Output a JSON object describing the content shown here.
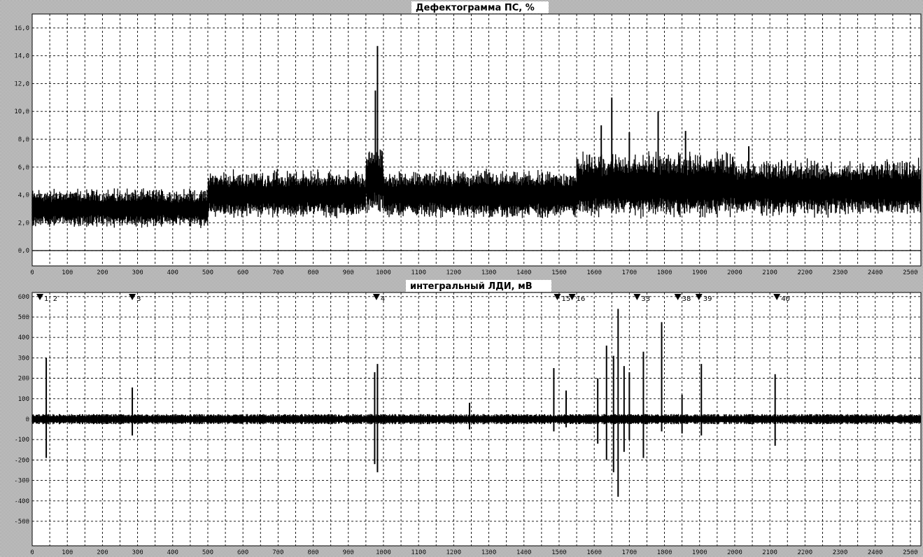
{
  "chart_data": [
    {
      "type": "line",
      "title": "Дефектограмма ПС, %",
      "ytick_labels": [
        "16,0",
        "14,0",
        "12,0",
        "10,0",
        "8,0",
        "6,0",
        "4,0",
        "2,0",
        "0,0"
      ],
      "y_ticks": [
        16,
        14,
        12,
        10,
        8,
        6,
        4,
        2,
        0
      ],
      "ylim": [
        -1.1,
        17.0
      ],
      "xlim": [
        0,
        2530
      ],
      "xtick_labels": [
        "0",
        "100",
        "200",
        "300",
        "400",
        "500",
        "600",
        "700",
        "800",
        "900",
        "1000",
        "1100",
        "1200",
        "1300",
        "1400",
        "1500",
        "1600",
        "1700",
        "1800",
        "1900",
        "2000",
        "2100",
        "2200",
        "2300",
        "2400",
        "2500"
      ],
      "x_ticks": [
        0,
        100,
        200,
        300,
        400,
        500,
        600,
        700,
        800,
        900,
        1000,
        1100,
        1200,
        1300,
        1400,
        1500,
        1600,
        1700,
        1800,
        1900,
        2000,
        2100,
        2200,
        2300,
        2400,
        2500
      ],
      "grid": true,
      "series": [
        {
          "signal": "noise band",
          "segments": [
            {
              "x_start": 0,
              "x_end": 500,
              "center": 3.0,
              "amplitude": 1.3
            },
            {
              "x_start": 500,
              "x_end": 950,
              "center": 4.0,
              "amplitude": 1.6
            },
            {
              "x_start": 950,
              "x_end": 1000,
              "center": 5.0,
              "amplitude": 2.2
            },
            {
              "x_start": 1000,
              "x_end": 1550,
              "center": 4.0,
              "amplitude": 1.6
            },
            {
              "x_start": 1550,
              "x_end": 2000,
              "center": 4.6,
              "amplitude": 2.2
            },
            {
              "x_start": 2000,
              "x_end": 2530,
              "center": 4.4,
              "amplitude": 1.9
            }
          ],
          "peaks": [
            {
              "x": 983,
              "y": 14.7
            },
            {
              "x": 977,
              "y": 11.5
            },
            {
              "x": 1620,
              "y": 9.0
            },
            {
              "x": 1650,
              "y": 11.0
            },
            {
              "x": 1782,
              "y": 10.0
            },
            {
              "x": 1700,
              "y": 8.5
            },
            {
              "x": 1860,
              "y": 8.6
            },
            {
              "x": 2040,
              "y": 7.5
            }
          ]
        }
      ]
    },
    {
      "type": "line",
      "title": "интегральный ЛДИ, мВ",
      "ytick_labels": [
        "600",
        "500",
        "400",
        "300",
        "200",
        "100",
        "0",
        "-100",
        "-200",
        "-300",
        "-400",
        "-500"
      ],
      "y_ticks": [
        600,
        500,
        400,
        300,
        200,
        100,
        0,
        -100,
        -200,
        -300,
        -400,
        -500
      ],
      "ylim": [
        -620,
        620
      ],
      "xlim": [
        0,
        2530
      ],
      "xtick_labels": [
        "0",
        "100",
        "200",
        "300",
        "400",
        "500",
        "600",
        "700",
        "800",
        "900",
        "1000",
        "1100",
        "1200",
        "1300",
        "1400",
        "1500",
        "1600",
        "1700",
        "1800",
        "1900",
        "2000",
        "2100",
        "2200",
        "2300",
        "2400",
        "2500"
      ],
      "x_ticks": [
        0,
        100,
        200,
        300,
        400,
        500,
        600,
        700,
        800,
        900,
        1000,
        1100,
        1200,
        1300,
        1400,
        1500,
        1600,
        1700,
        1800,
        1900,
        2000,
        2100,
        2200,
        2300,
        2400,
        2500
      ],
      "grid": true,
      "markers": [
        {
          "x": 22,
          "label": "1, 2"
        },
        {
          "x": 285,
          "label": "3"
        },
        {
          "x": 980,
          "label": "4"
        },
        {
          "x": 1495,
          "label": "15"
        },
        {
          "x": 1537,
          "label": "16"
        },
        {
          "x": 1722,
          "label": "33"
        },
        {
          "x": 1838,
          "label": "38"
        },
        {
          "x": 1898,
          "label": "39"
        },
        {
          "x": 2120,
          "label": "40"
        }
      ],
      "series": [
        {
          "signal": "baseline noise",
          "center": 0,
          "amplitude": 25,
          "spikes": [
            {
              "x": 40,
              "y_max": 300,
              "y_min": -190
            },
            {
              "x": 285,
              "y_max": 155,
              "y_min": -80
            },
            {
              "x": 975,
              "y_max": 230,
              "y_min": -220
            },
            {
              "x": 983,
              "y_max": 270,
              "y_min": -260
            },
            {
              "x": 1245,
              "y_max": 80,
              "y_min": -50
            },
            {
              "x": 1485,
              "y_max": 250,
              "y_min": -60
            },
            {
              "x": 1520,
              "y_max": 140,
              "y_min": -40
            },
            {
              "x": 1610,
              "y_max": 200,
              "y_min": -120
            },
            {
              "x": 1635,
              "y_max": 360,
              "y_min": -200
            },
            {
              "x": 1655,
              "y_max": 310,
              "y_min": -260
            },
            {
              "x": 1668,
              "y_max": 540,
              "y_min": -380
            },
            {
              "x": 1685,
              "y_max": 260,
              "y_min": -160
            },
            {
              "x": 1700,
              "y_max": 230,
              "y_min": -100
            },
            {
              "x": 1740,
              "y_max": 330,
              "y_min": -190
            },
            {
              "x": 1792,
              "y_max": 475,
              "y_min": -60
            },
            {
              "x": 1850,
              "y_max": 120,
              "y_min": -70
            },
            {
              "x": 1905,
              "y_max": 270,
              "y_min": -80
            },
            {
              "x": 2115,
              "y_max": 220,
              "y_min": -130
            }
          ]
        }
      ]
    }
  ]
}
